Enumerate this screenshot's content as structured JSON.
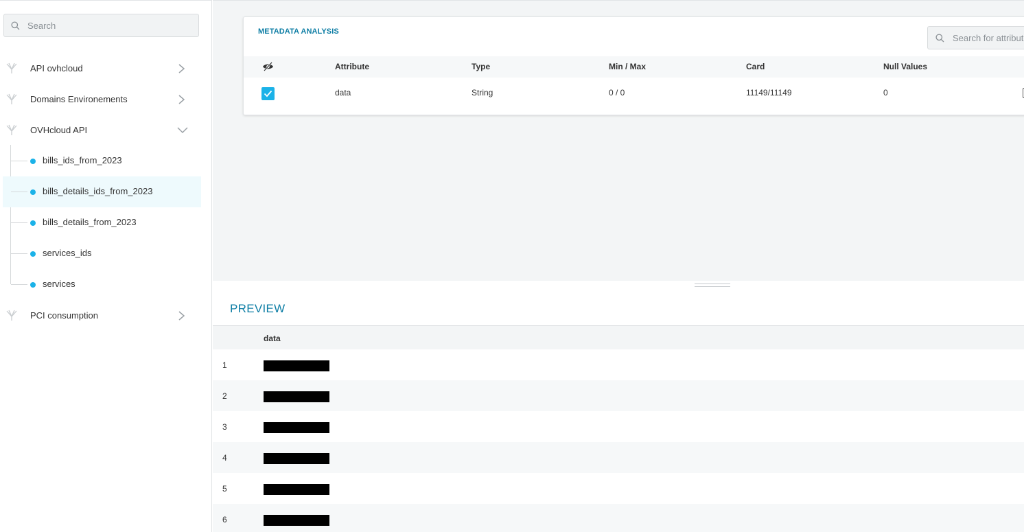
{
  "sidebar": {
    "search_placeholder": "Search",
    "groups": [
      {
        "label": "API ovhcloud",
        "expanded": false
      },
      {
        "label": "Domains Environements",
        "expanded": false
      },
      {
        "label": "OVHcloud API",
        "expanded": true,
        "children": [
          "bills_ids_from_2023",
          "bills_details_ids_from_2023",
          "bills_details_from_2023",
          "services_ids",
          "services"
        ],
        "selected_child": "bills_details_ids_from_2023"
      },
      {
        "label": "PCI consumption",
        "expanded": false
      }
    ]
  },
  "metadata": {
    "title": "METADATA ANALYSIS",
    "search_placeholder": "Search for attribute",
    "columns": {
      "visibility_icon": "eye-off-icon",
      "attribute": "Attribute",
      "type": "Type",
      "minmax": "Min / Max",
      "card": "Card",
      "nulls": "Null Values"
    },
    "rows": [
      {
        "checked": true,
        "attribute": "data",
        "type": "String",
        "minmax": "0 / 0",
        "card": "11149/11149",
        "nulls": "0"
      }
    ]
  },
  "preview": {
    "title": "PREVIEW",
    "column": "data",
    "rows": [
      "1",
      "2",
      "3",
      "4",
      "5",
      "6"
    ],
    "values_redacted": true
  },
  "colors": {
    "accent": "#0e7ea5",
    "dot": "#1bb2e8",
    "selected_bg": "#eefafd"
  }
}
